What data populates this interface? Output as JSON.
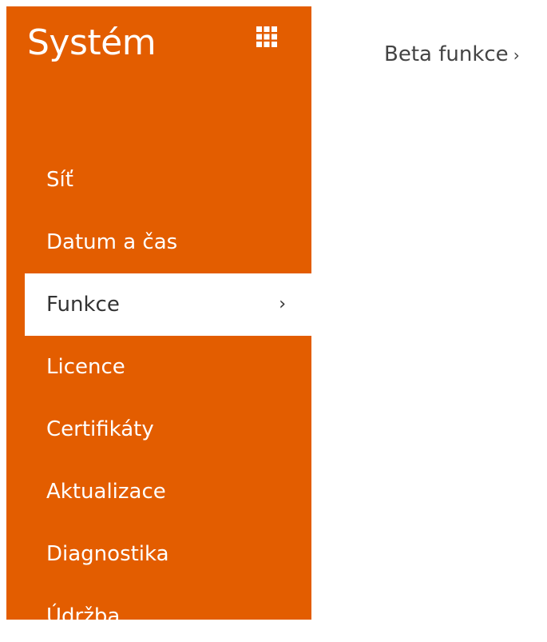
{
  "sidebar": {
    "title": "Systém",
    "grid_icon": "apps-grid-icon",
    "accent_color": "#e35d00",
    "items": [
      {
        "label": "Síť",
        "active": false
      },
      {
        "label": "Datum a čas",
        "active": false
      },
      {
        "label": "Funkce",
        "active": true
      },
      {
        "label": "Licence",
        "active": false
      },
      {
        "label": "Certifikáty",
        "active": false
      },
      {
        "label": "Aktualizace",
        "active": false
      },
      {
        "label": "Diagnostika",
        "active": false
      },
      {
        "label": "Údržba",
        "active": false
      }
    ],
    "active_chevron": "›"
  },
  "main": {
    "link_label": "Beta funkce",
    "link_chevron": "›"
  }
}
